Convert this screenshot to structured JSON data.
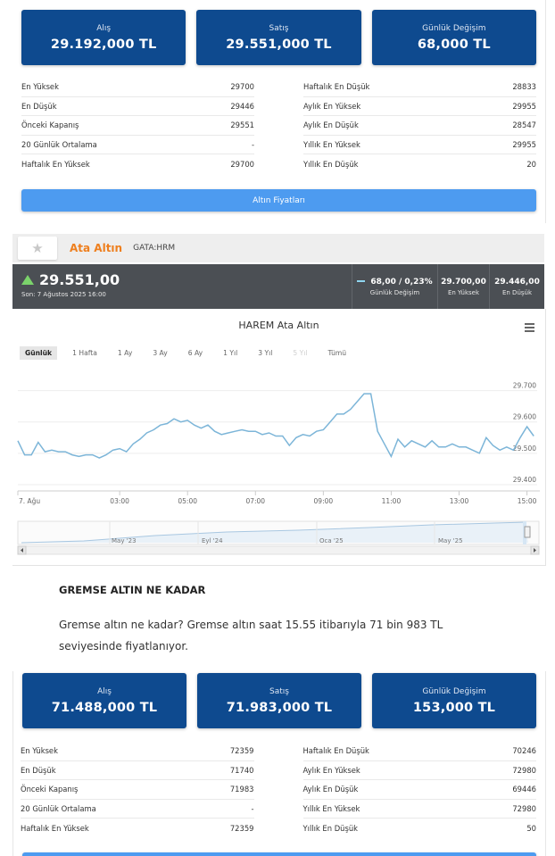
{
  "gold1": {
    "boxes": [
      {
        "label": "Alış",
        "value": "29.192,000 TL"
      },
      {
        "label": "Satış",
        "value": "29.551,000 TL"
      },
      {
        "label": "Günlük Değişim",
        "value": "68,000 TL"
      }
    ],
    "left_stats": [
      {
        "label": "En Yüksek",
        "value": "29700"
      },
      {
        "label": "En Düşük",
        "value": "29446"
      },
      {
        "label": "Önceki Kapanış",
        "value": "29551"
      },
      {
        "label": "20 Günlük Ortalama",
        "value": "-"
      },
      {
        "label": "Haftalık En Yüksek",
        "value": "29700"
      }
    ],
    "right_stats": [
      {
        "label": "Haftalık En Düşük",
        "value": "28833"
      },
      {
        "label": "Aylık En Yüksek",
        "value": "29955"
      },
      {
        "label": "Aylık En Düşük",
        "value": "28547"
      },
      {
        "label": "Yıllık En Yüksek",
        "value": "29955"
      },
      {
        "label": "Yıllık En Düşük",
        "value": "20"
      }
    ],
    "button": "Altın Fiyatları"
  },
  "ata": {
    "title": "Ata Altın",
    "code": "GATA:HRM",
    "price": "29.551,00",
    "date": "Son: 7 Ağustos 2025 16:00",
    "change_value": "68,00 / 0,23%",
    "change_label": "Günlük Değişim",
    "high_value": "29.700,00",
    "high_label": "En Yüksek",
    "low_value": "29.446,00",
    "low_label": "En Düşük"
  },
  "chart": {
    "title": "HAREM Ata Altın",
    "ranges": [
      {
        "label": "Günlük",
        "state": "active"
      },
      {
        "label": "1 Hafta",
        "state": ""
      },
      {
        "label": "1 Ay",
        "state": ""
      },
      {
        "label": "3 Ay",
        "state": ""
      },
      {
        "label": "6 Ay",
        "state": ""
      },
      {
        "label": "1 Yıl",
        "state": ""
      },
      {
        "label": "3 Yıl",
        "state": ""
      },
      {
        "label": "5 Yıl",
        "state": "disabled"
      },
      {
        "label": "Tümü",
        "state": ""
      }
    ],
    "navigator_labels": [
      "May '23",
      "Eyl '24",
      "Oca '25",
      "May '25"
    ]
  },
  "chart_data": {
    "type": "line",
    "title": "HAREM Ata Altın",
    "x_ticks": [
      "7. Ağu",
      "03:00",
      "05:00",
      "07:00",
      "09:00",
      "11:00",
      "13:00",
      "15:00"
    ],
    "x_tick_hours": [
      0,
      3,
      5,
      7,
      9,
      11,
      13,
      15
    ],
    "y_ticks": [
      "29.700",
      "29.600",
      "29.500",
      "29.400"
    ],
    "y_tick_values": [
      29700,
      29600,
      29500,
      29400
    ],
    "ylim": [
      29400,
      29700
    ],
    "xlim": [
      0,
      15.3
    ],
    "series": [
      {
        "x": [
          0,
          0.2,
          0.4,
          0.6,
          0.8,
          1.0,
          1.2,
          1.4,
          1.6,
          1.8,
          2.0,
          2.2,
          2.4,
          2.6,
          2.8,
          3.0,
          3.2,
          3.4,
          3.6,
          3.8,
          4.0,
          4.2,
          4.4,
          4.6,
          4.8,
          5.0,
          5.2,
          5.4,
          5.6,
          5.8,
          6.0,
          6.2,
          6.4,
          6.6,
          6.8,
          7.0,
          7.2,
          7.4,
          7.6,
          7.8,
          8.0,
          8.2,
          8.4,
          8.6,
          8.8,
          9.0,
          9.2,
          9.4,
          9.6,
          9.8,
          10.0,
          10.2,
          10.4,
          10.6,
          10.8,
          11.0,
          11.2,
          11.4,
          11.6,
          11.8,
          12.0,
          12.2,
          12.4,
          12.6,
          12.8,
          13.0,
          13.2,
          13.4,
          13.6,
          13.8,
          14.0,
          14.2,
          14.4,
          14.6,
          14.8,
          15.0,
          15.2
        ],
        "y": [
          29540,
          29495,
          29495,
          29535,
          29505,
          29510,
          29505,
          29505,
          29495,
          29490,
          29495,
          29495,
          29485,
          29495,
          29510,
          29515,
          29505,
          29530,
          29545,
          29565,
          29575,
          29590,
          29595,
          29610,
          29600,
          29605,
          29590,
          29580,
          29590,
          29570,
          29560,
          29565,
          29570,
          29575,
          29570,
          29570,
          29560,
          29565,
          29555,
          29555,
          29525,
          29550,
          29560,
          29555,
          29570,
          29575,
          29600,
          29625,
          29625,
          29640,
          29665,
          29690,
          29690,
          29570,
          29530,
          29490,
          29545,
          29520,
          29540,
          29530,
          29520,
          29540,
          29520,
          29520,
          29530,
          29520,
          29520,
          29510,
          29500,
          29550,
          29525,
          29510,
          29520,
          29510,
          29550,
          29585,
          29555
        ]
      }
    ]
  },
  "article": {
    "title": "GREMSE ALTIN NE KADAR",
    "text": "Gremse altın ne kadar? Gremse altın saat 15.55 itibarıyla 71 bin 983 TL seviyesinde fiyatlanıyor."
  },
  "gold2": {
    "boxes": [
      {
        "label": "Alış",
        "value": "71.488,000 TL"
      },
      {
        "label": "Satış",
        "value": "71.983,000 TL"
      },
      {
        "label": "Günlük Değişim",
        "value": "153,000 TL"
      }
    ],
    "left_stats": [
      {
        "label": "En Yüksek",
        "value": "72359"
      },
      {
        "label": "En Düşük",
        "value": "71740"
      },
      {
        "label": "Önceki Kapanış",
        "value": "71983"
      },
      {
        "label": "20 Günlük Ortalama",
        "value": "-"
      },
      {
        "label": "Haftalık En Yüksek",
        "value": "72359"
      }
    ],
    "right_stats": [
      {
        "label": "Haftalık En Düşük",
        "value": "70246"
      },
      {
        "label": "Aylık En Yüksek",
        "value": "72980"
      },
      {
        "label": "Aylık En Düşük",
        "value": "69446"
      },
      {
        "label": "Yıllık En Yüksek",
        "value": "72980"
      },
      {
        "label": "Yıllık En Düşük",
        "value": "50"
      }
    ]
  }
}
